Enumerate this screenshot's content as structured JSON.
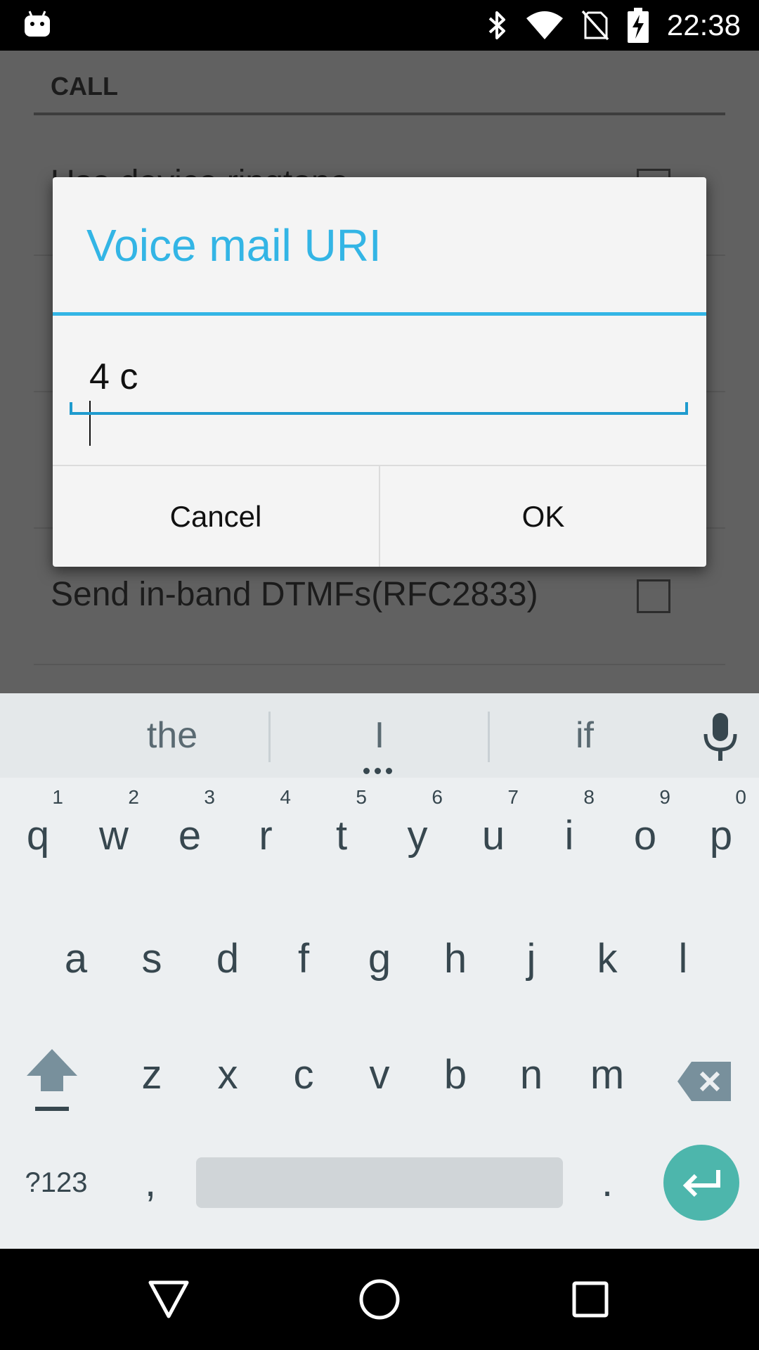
{
  "status_bar": {
    "time": "22:38",
    "icons": [
      "android-notification-icon",
      "bluetooth-icon",
      "wifi-icon",
      "no-sim-icon",
      "battery-charging-icon"
    ]
  },
  "settings": {
    "category": "CALL",
    "partial_title": "Use device ringtone",
    "visible_pref": {
      "title": "Send in-band DTMFs(RFC2833)",
      "checked": false
    }
  },
  "dialog": {
    "title": "Voice mail URI",
    "field_value": "4 c",
    "cancel_label": "Cancel",
    "ok_label": "OK",
    "accent_color": "#33b5e5"
  },
  "keyboard": {
    "suggestions": [
      "the",
      "I",
      "if"
    ],
    "row1": [
      {
        "key": "q",
        "hint": "1"
      },
      {
        "key": "w",
        "hint": "2"
      },
      {
        "key": "e",
        "hint": "3"
      },
      {
        "key": "r",
        "hint": "4"
      },
      {
        "key": "t",
        "hint": "5"
      },
      {
        "key": "y",
        "hint": "6"
      },
      {
        "key": "u",
        "hint": "7"
      },
      {
        "key": "i",
        "hint": "8"
      },
      {
        "key": "o",
        "hint": "9"
      },
      {
        "key": "p",
        "hint": "0"
      }
    ],
    "row2": [
      "a",
      "s",
      "d",
      "f",
      "g",
      "h",
      "j",
      "k",
      "l"
    ],
    "row3": [
      "z",
      "x",
      "c",
      "v",
      "b",
      "n",
      "m"
    ],
    "symbols_label": "?123",
    "comma_label": ",",
    "period_label": ".",
    "enter_color": "#4db6ac"
  },
  "nav_bar": {
    "icons": [
      "back-icon",
      "home-icon",
      "recents-icon"
    ]
  }
}
